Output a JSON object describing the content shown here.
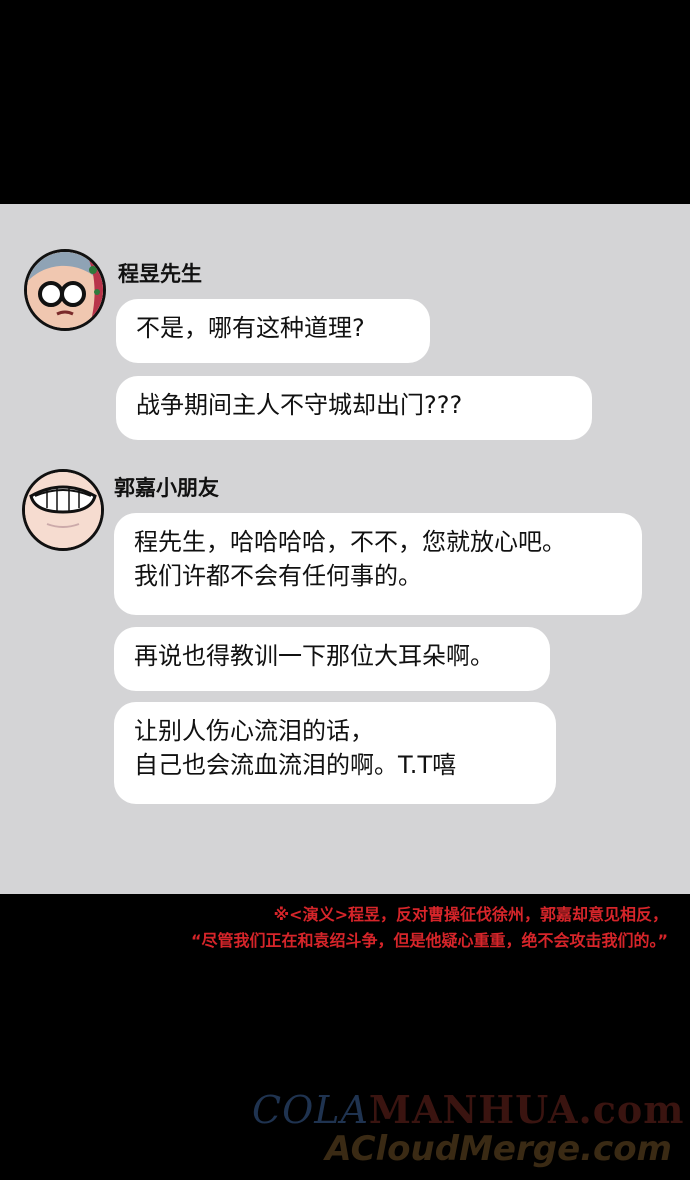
{
  "messages": {
    "cheng": {
      "name": "程昱先生",
      "bubbles": [
        {
          "lines": [
            "不是，哪有这种道理?"
          ]
        },
        {
          "lines": [
            "战争期间主人不守城却出门???"
          ]
        }
      ]
    },
    "guo": {
      "name": "郭嘉小朋友",
      "bubbles": [
        {
          "lines": [
            "程先生，哈哈哈哈，不不，您就放心吧。",
            "我们许都不会有任何事的。"
          ]
        },
        {
          "lines": [
            "再说也得教训一下那位大耳朵啊。"
          ]
        },
        {
          "lines": [
            "让别人伤心流泪的话，",
            "自己也会流血流泪的啊。T.T嘻"
          ]
        }
      ]
    }
  },
  "footnote": {
    "line1": "※<演义>程昱，反对曹操征伐徐州，郭嘉却意见相反，",
    "line2": "“尽管我们正在和袁绍斗争，但是他疑心重重，绝不会攻击我们的。”"
  },
  "watermark": {
    "cola": "COLA",
    "manhua": "MANHUA",
    "dotcom": ".com",
    "line2": "ACloudMerge.com"
  },
  "colors": {
    "panel_bg": "#d4d4d6",
    "bubble_bg": "#ffffff",
    "note_red": "#d6252a",
    "background": "#000000"
  }
}
